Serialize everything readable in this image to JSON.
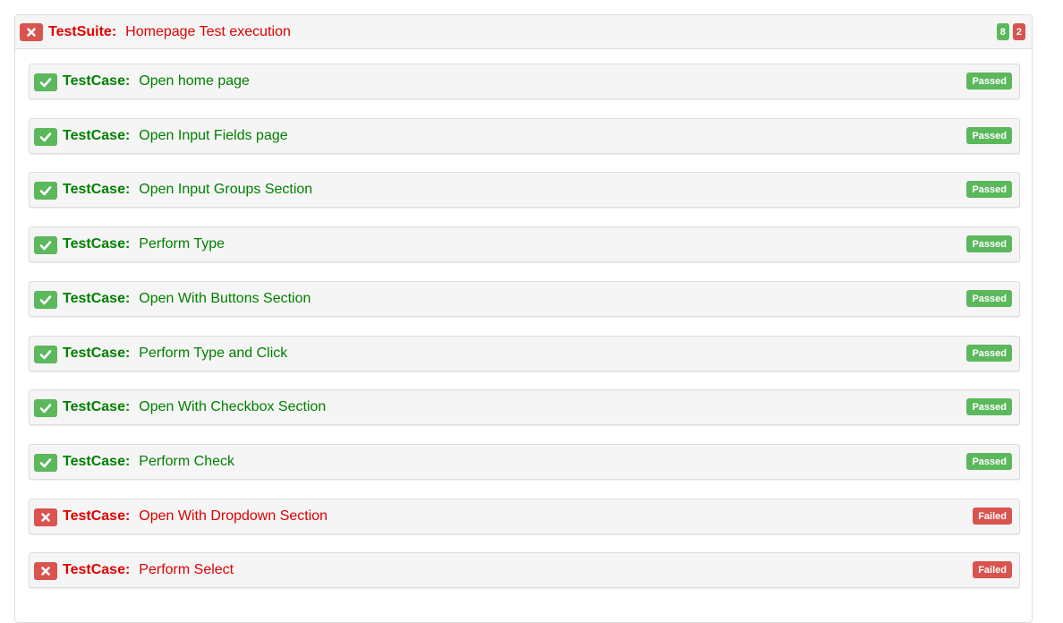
{
  "suite": {
    "keyword": "TestSuite:",
    "name": "Homepage Test execution",
    "status": "failed",
    "passed_count": "8",
    "failed_count": "2"
  },
  "cases": [
    {
      "keyword": "TestCase:",
      "name": "Open home page",
      "status": "Passed"
    },
    {
      "keyword": "TestCase:",
      "name": "Open Input Fields page",
      "status": "Passed"
    },
    {
      "keyword": "TestCase:",
      "name": "Open Input Groups Section",
      "status": "Passed"
    },
    {
      "keyword": "TestCase:",
      "name": "Perform Type",
      "status": "Passed"
    },
    {
      "keyword": "TestCase:",
      "name": "Open With Buttons Section",
      "status": "Passed"
    },
    {
      "keyword": "TestCase:",
      "name": "Perform Type and Click",
      "status": "Passed"
    },
    {
      "keyword": "TestCase:",
      "name": "Open With Checkbox Section",
      "status": "Passed"
    },
    {
      "keyword": "TestCase:",
      "name": "Perform Check",
      "status": "Passed"
    },
    {
      "keyword": "TestCase:",
      "name": "Open With Dropdown Section",
      "status": "Failed"
    },
    {
      "keyword": "TestCase:",
      "name": "Perform Select",
      "status": "Failed"
    }
  ],
  "colors": {
    "pass": "#5cb85c",
    "fail": "#d9534f",
    "pass_text": "#008000",
    "fail_text": "#e00000"
  },
  "icons": {
    "pass": "check-icon",
    "fail": "cross-icon"
  }
}
